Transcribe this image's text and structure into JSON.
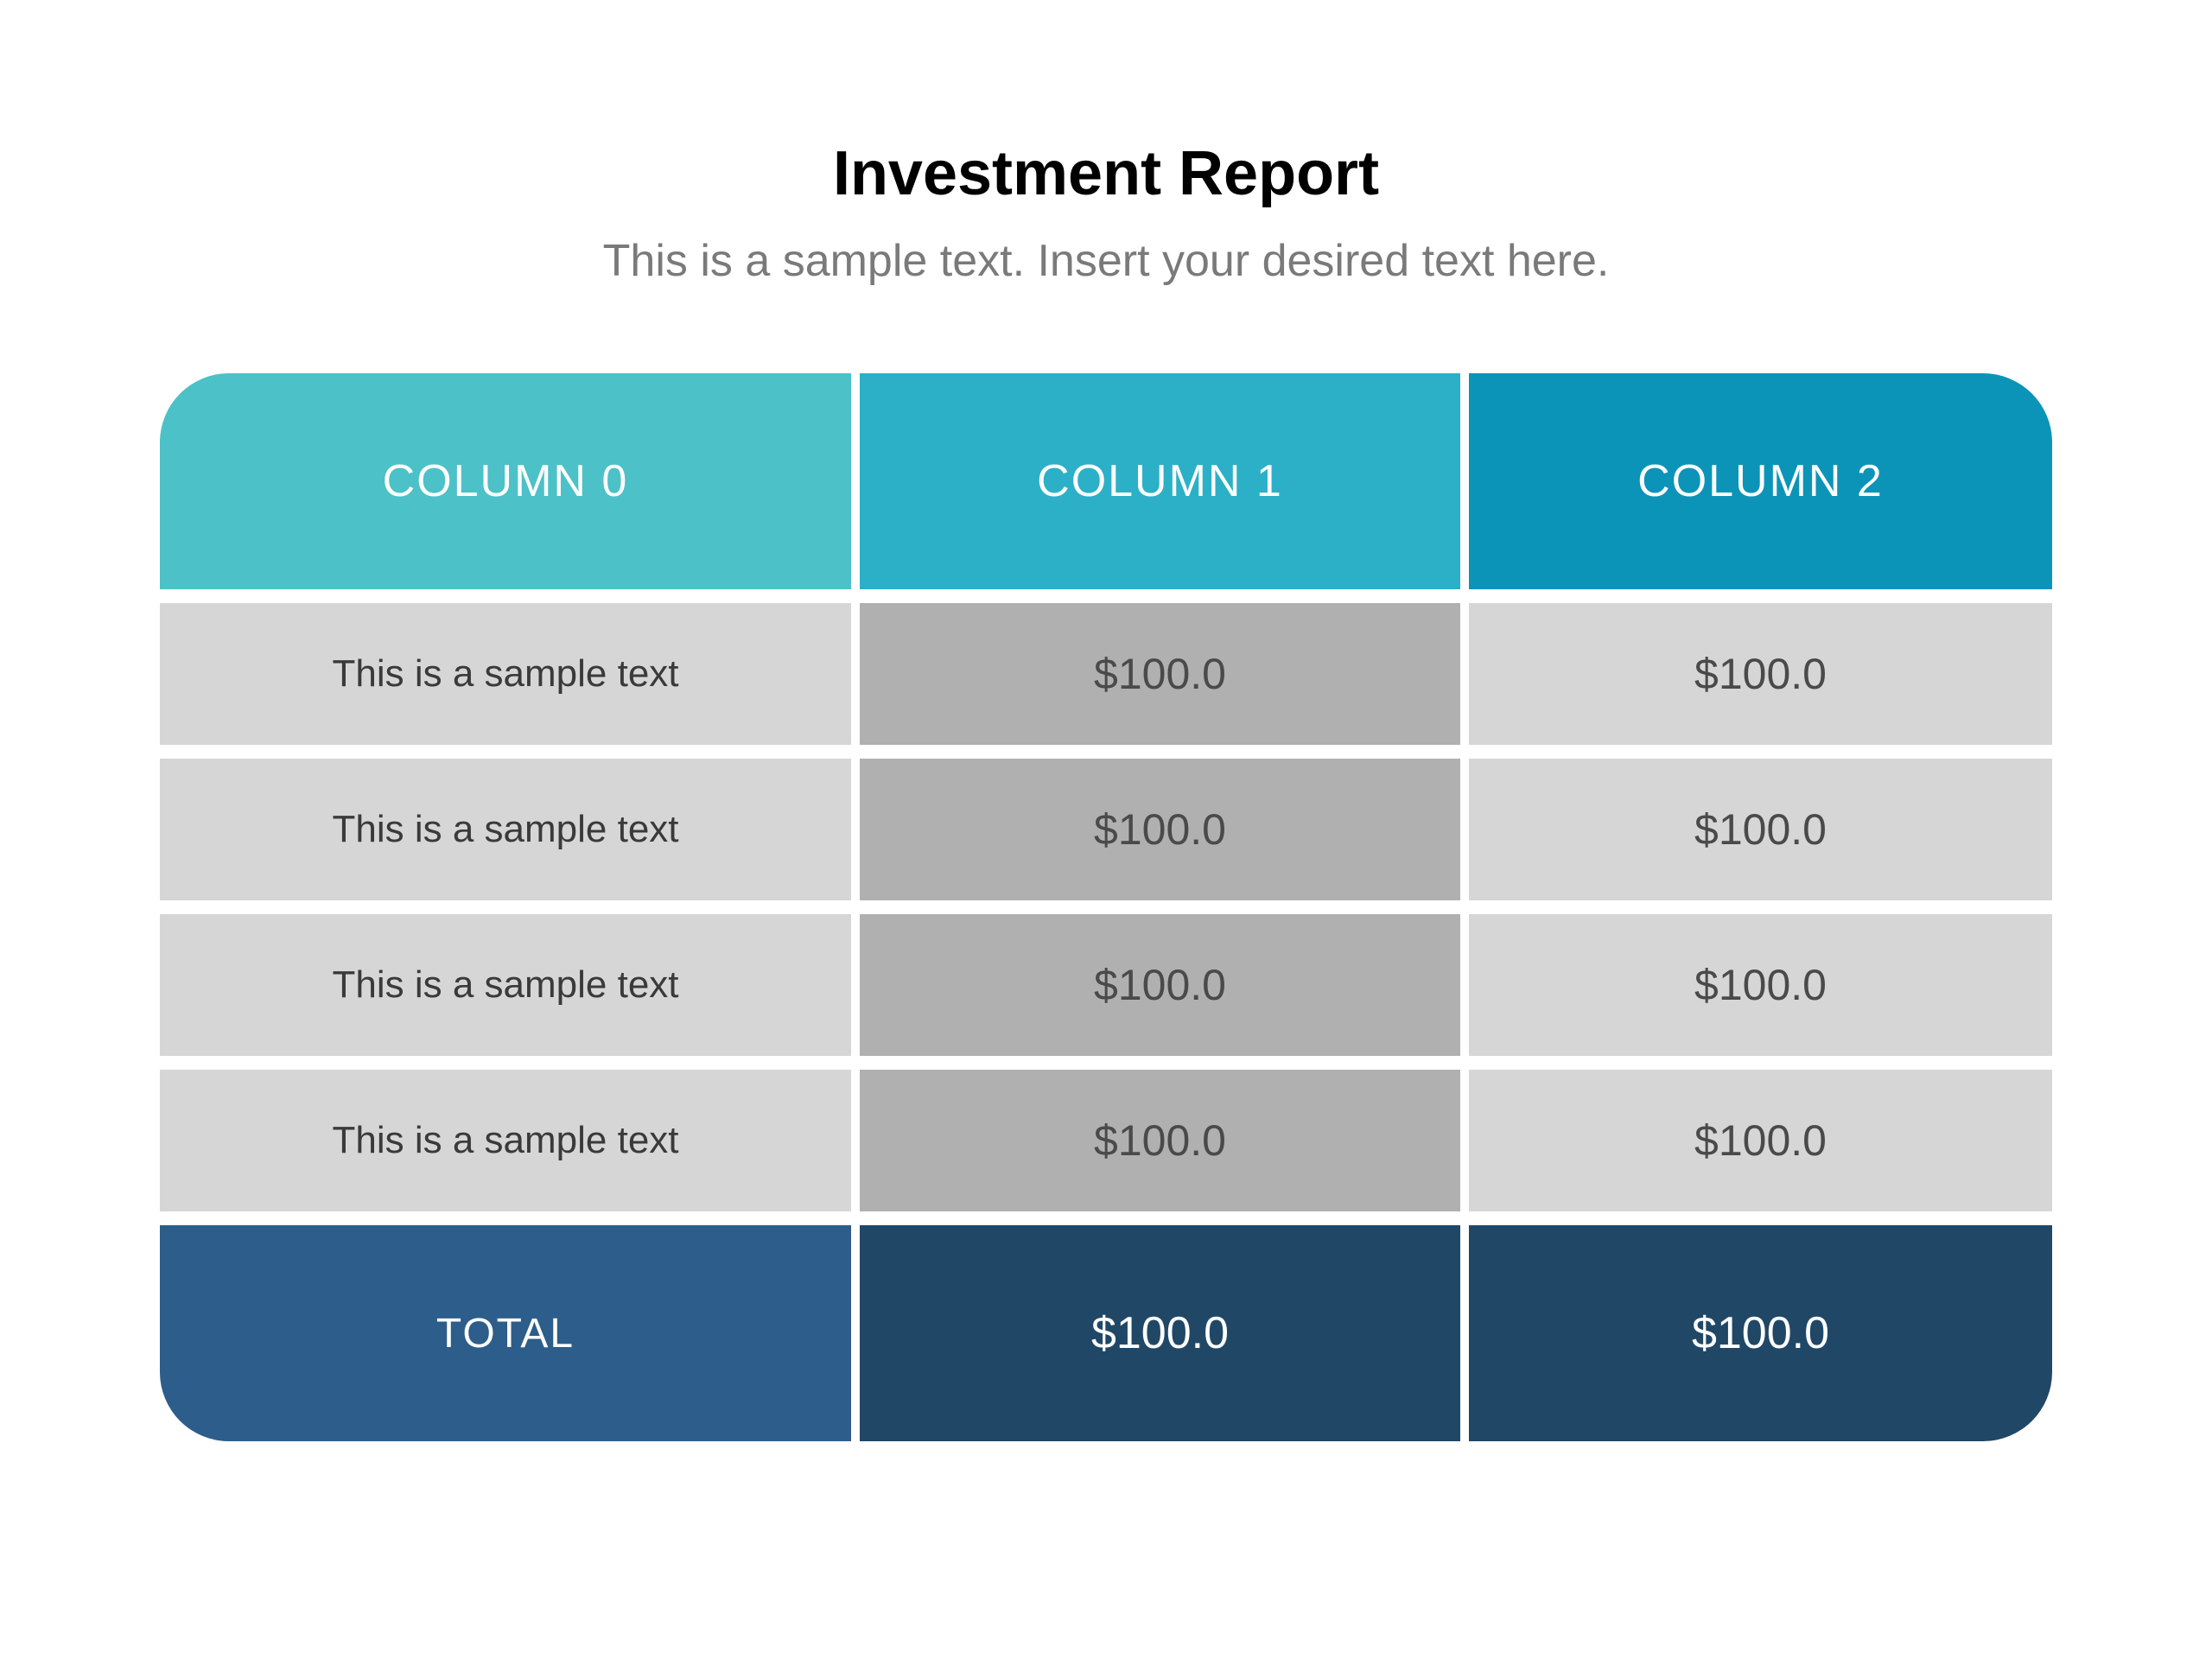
{
  "title": "Investment Report",
  "subtitle": "This is a sample text. Insert your desired text here.",
  "table": {
    "headers": [
      "COLUMN 0",
      "COLUMN 1",
      "COLUMN 2"
    ],
    "rows": [
      {
        "label": "This is a sample text",
        "col1": "$100.0",
        "col2": "$100.0"
      },
      {
        "label": "This is a sample text",
        "col1": "$100.0",
        "col2": "$100.0"
      },
      {
        "label": "This is a sample text",
        "col1": "$100.0",
        "col2": "$100.0"
      },
      {
        "label": "This is a sample text",
        "col1": "$100.0",
        "col2": "$100.0"
      }
    ],
    "total": {
      "label": "TOTAL",
      "col1": "$100.0",
      "col2": "$100.0"
    }
  },
  "colors": {
    "header0": "#4cc1c7",
    "header1": "#2bb0c7",
    "header2": "#0c94b8",
    "rowLight": "#d6d6d6",
    "rowDark": "#b0b0b0",
    "total0": "#2d5d8a",
    "total12": "#214766"
  }
}
